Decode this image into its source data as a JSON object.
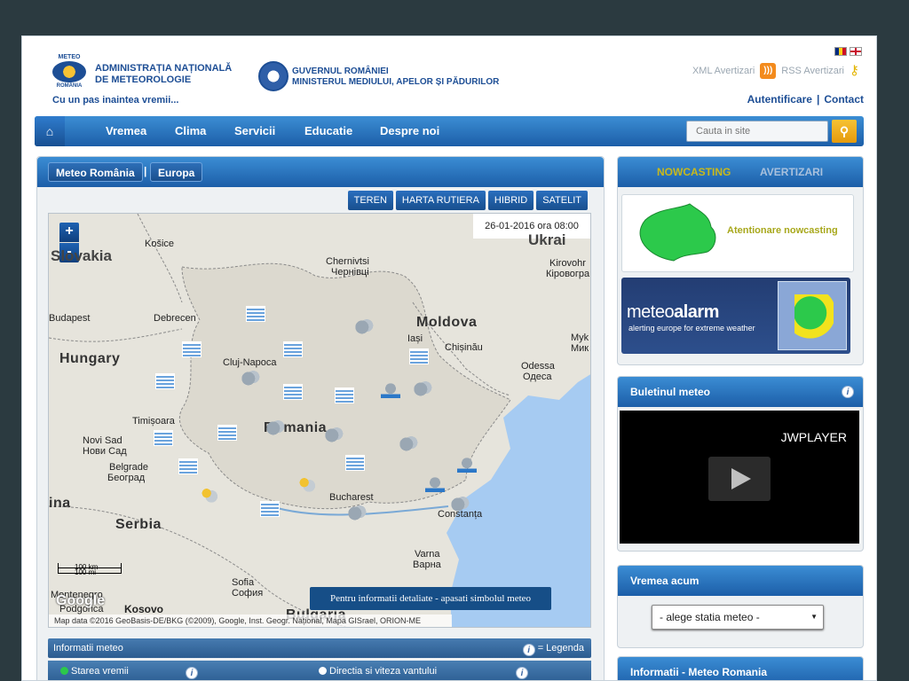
{
  "header": {
    "logo_text_top": "METEO",
    "logo_text_bottom": "ROMÂNIA",
    "anm_line1": "ADMINISTRAȚIA NAȚIONALĂ",
    "anm_line2": "DE METEOROLOGIE",
    "slogan": "Cu un pas inaintea vremii...",
    "gov_line1": "GUVERNUL ROMÂNIEI",
    "gov_line2": "MINISTERUL MEDIULUI, APELOR ȘI PĂDURILOR",
    "xml_label": "XML Avertizari",
    "rss_label": "RSS Avertizari",
    "auth_label": "Autentificare",
    "contact_label": "Contact"
  },
  "nav": {
    "items": [
      "Vremea",
      "Clima",
      "Servicii",
      "Educatie",
      "Despre noi"
    ],
    "search_placeholder": "Cauta in site"
  },
  "left_panel": {
    "tabs": [
      "Meteo România",
      "Europa"
    ],
    "separator": "|",
    "map_types": [
      "TEREN",
      "HARTA RUTIERA",
      "HIBRID",
      "SATELIT"
    ],
    "timestamp": "26-01-2016 ora 08:00",
    "zoom_in": "+",
    "zoom_out": "-",
    "map_note": "Pentru informatii detaliate - apasati simbolul meteo",
    "google_label": "Google",
    "copyright": "Map data ©2016 GeoBasis-DE/BKG (©2009), Google, Inst. Geogr. Național, Mapa GISrael, ORION-ME",
    "scale_top": "100 km",
    "scale_bottom": "100 mi",
    "labels": [
      {
        "text": "Košice"
      },
      {
        "text": "Chernivtsi"
      },
      {
        "text": "Чернівці"
      },
      {
        "text": "Kirovohr"
      },
      {
        "text": "Кіровогра"
      },
      {
        "text": "Budapest"
      },
      {
        "text": "Debrecen"
      },
      {
        "text": "Iași"
      },
      {
        "text": "Chișinău"
      },
      {
        "text": "Cluj-Napoca"
      },
      {
        "text": "Odessa"
      },
      {
        "text": "Одеса"
      },
      {
        "text": "Timișoara"
      },
      {
        "text": "Novi Sad"
      },
      {
        "text": "Нови Сад"
      },
      {
        "text": "Belgrade"
      },
      {
        "text": "Београд"
      },
      {
        "text": "Bucharest"
      },
      {
        "text": "Constanța"
      },
      {
        "text": "Varna"
      },
      {
        "text": "Варна"
      },
      {
        "text": "Sofia"
      },
      {
        "text": "София"
      },
      {
        "text": "Podgorica"
      },
      {
        "text": "Myk"
      },
      {
        "text": "Мик"
      },
      {
        "text": "Montenegro"
      }
    ],
    "country_labels": [
      {
        "text": "Slovakia"
      },
      {
        "text": "Ukrai"
      },
      {
        "text": "Moldova"
      },
      {
        "text": "Hungary"
      },
      {
        "text": "Romania"
      },
      {
        "text": "Serbia"
      },
      {
        "text": "Kosovo"
      },
      {
        "text": "Bulgaria"
      },
      {
        "text": "ina"
      }
    ],
    "info_title": "Informatii meteo",
    "info_legend": "= Legenda",
    "info_columns": [
      "Starea vremii",
      "Directia si viteza vantului"
    ]
  },
  "right_column": {
    "nowcasting_tab": "NOWCASTING",
    "warnings_tab": "AVERTIZARI",
    "nowcasting_text": "Atentionare nowcasting",
    "alarm_brand_a": "meteo",
    "alarm_brand_b": "alarm",
    "alarm_slogan": "alerting europe for extreme weather",
    "bulletin_title": "Buletinul meteo",
    "jw_label": "JWPLAYER",
    "weather_now_title": "Vremea acum",
    "station_select": "- alege statia meteo -",
    "info_title": "Informatii - Meteo Romania"
  },
  "colors": {
    "nav_blue": "#1c5ea8",
    "nowcasting_active": "#c9b91c",
    "alert_green": "#2cc94b"
  }
}
